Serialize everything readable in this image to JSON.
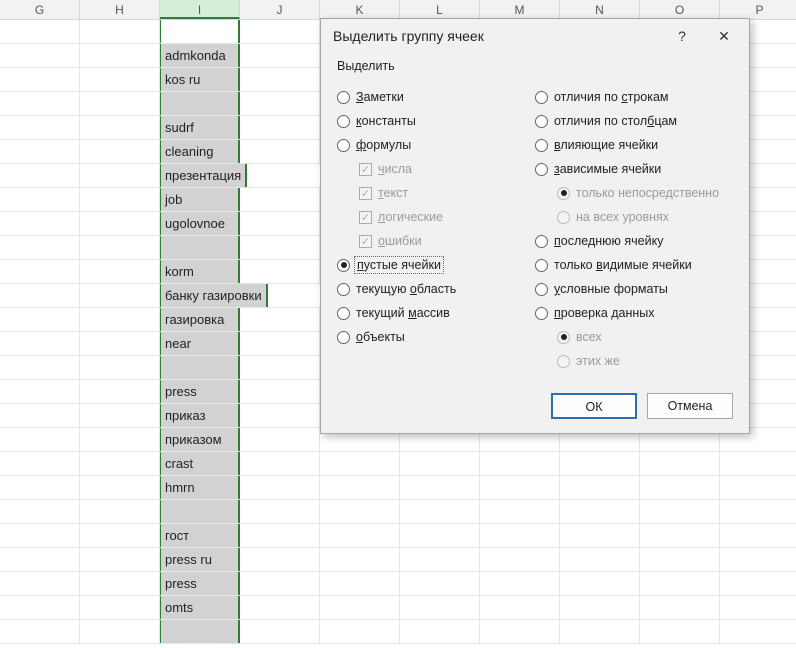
{
  "sheet": {
    "columns": [
      "G",
      "H",
      "I",
      "J",
      "K",
      "L",
      "M",
      "N",
      "O",
      "P"
    ],
    "selected_col_index": 2,
    "cells_col_i": [
      "",
      "admkonda",
      "kos ru",
      "",
      "sudrf",
      "cleaning",
      "презентация",
      "job",
      "ugolovnoe",
      "",
      "korm",
      "банку газировки",
      "газировка",
      "near",
      "",
      "press",
      "приказ",
      "приказом",
      "crast",
      "hmrn",
      "",
      "гост",
      "press ru",
      "press",
      "omts",
      ""
    ],
    "overflow_rows": [
      6,
      11,
      12
    ]
  },
  "dialog": {
    "title": "Выделить группу ячеек",
    "group_label": "Выделить",
    "left_options": [
      {
        "label": "Заметки",
        "accel": "З",
        "type": "radio",
        "checked": false
      },
      {
        "label": "константы",
        "accel": "к",
        "type": "radio",
        "checked": false
      },
      {
        "label": "формулы",
        "accel": "ф",
        "type": "radio",
        "checked": false
      },
      {
        "label": "числа",
        "accel": "ч",
        "type": "chk",
        "checked": true,
        "indent": true,
        "disabled": true
      },
      {
        "label": "текст",
        "accel": "т",
        "type": "chk",
        "checked": true,
        "indent": true,
        "disabled": true
      },
      {
        "label": "логические",
        "accel": "л",
        "type": "chk",
        "checked": true,
        "indent": true,
        "disabled": true
      },
      {
        "label": "ошибки",
        "accel": "о",
        "type": "chk",
        "checked": true,
        "indent": true,
        "disabled": true
      },
      {
        "label": "пустые ячейки",
        "accel": "п",
        "type": "radio",
        "checked": true,
        "focused": true
      },
      {
        "label": "текущую область",
        "accel": "о",
        "type": "radio",
        "checked": false
      },
      {
        "label": "текущий массив",
        "accel": "м",
        "type": "radio",
        "checked": false
      },
      {
        "label": "объекты",
        "accel": "о",
        "type": "radio",
        "checked": false
      }
    ],
    "right_options": [
      {
        "label": "отличия по строкам",
        "accel": "с",
        "type": "radio",
        "checked": false
      },
      {
        "label": "отличия по столбцам",
        "accel": "б",
        "type": "radio",
        "checked": false
      },
      {
        "label": "влияющие ячейки",
        "accel": "в",
        "type": "radio",
        "checked": false
      },
      {
        "label": "зависимые ячейки",
        "accel": "з",
        "type": "radio",
        "checked": false
      },
      {
        "label": "только непосредственно",
        "accel": "",
        "type": "radio",
        "checked": true,
        "indent": true,
        "disabled": true
      },
      {
        "label": "на всех уровнях",
        "accel": "",
        "type": "radio",
        "checked": false,
        "indent": true,
        "disabled": true
      },
      {
        "label": "последнюю ячейку",
        "accel": "п",
        "type": "radio",
        "checked": false
      },
      {
        "label": "только видимые ячейки",
        "accel": "в",
        "type": "radio",
        "checked": false
      },
      {
        "label": "условные форматы",
        "accel": "у",
        "type": "radio",
        "checked": false
      },
      {
        "label": "проверка данных",
        "accel": "п",
        "type": "radio",
        "checked": false
      },
      {
        "label": "всех",
        "accel": "",
        "type": "radio",
        "checked": true,
        "indent": true,
        "disabled": true
      },
      {
        "label": "этих же",
        "accel": "",
        "type": "radio",
        "checked": false,
        "indent": true,
        "disabled": true
      }
    ],
    "ok_label": "ОК",
    "cancel_label": "Отмена"
  },
  "help_icon": "?",
  "close_icon": "✕"
}
